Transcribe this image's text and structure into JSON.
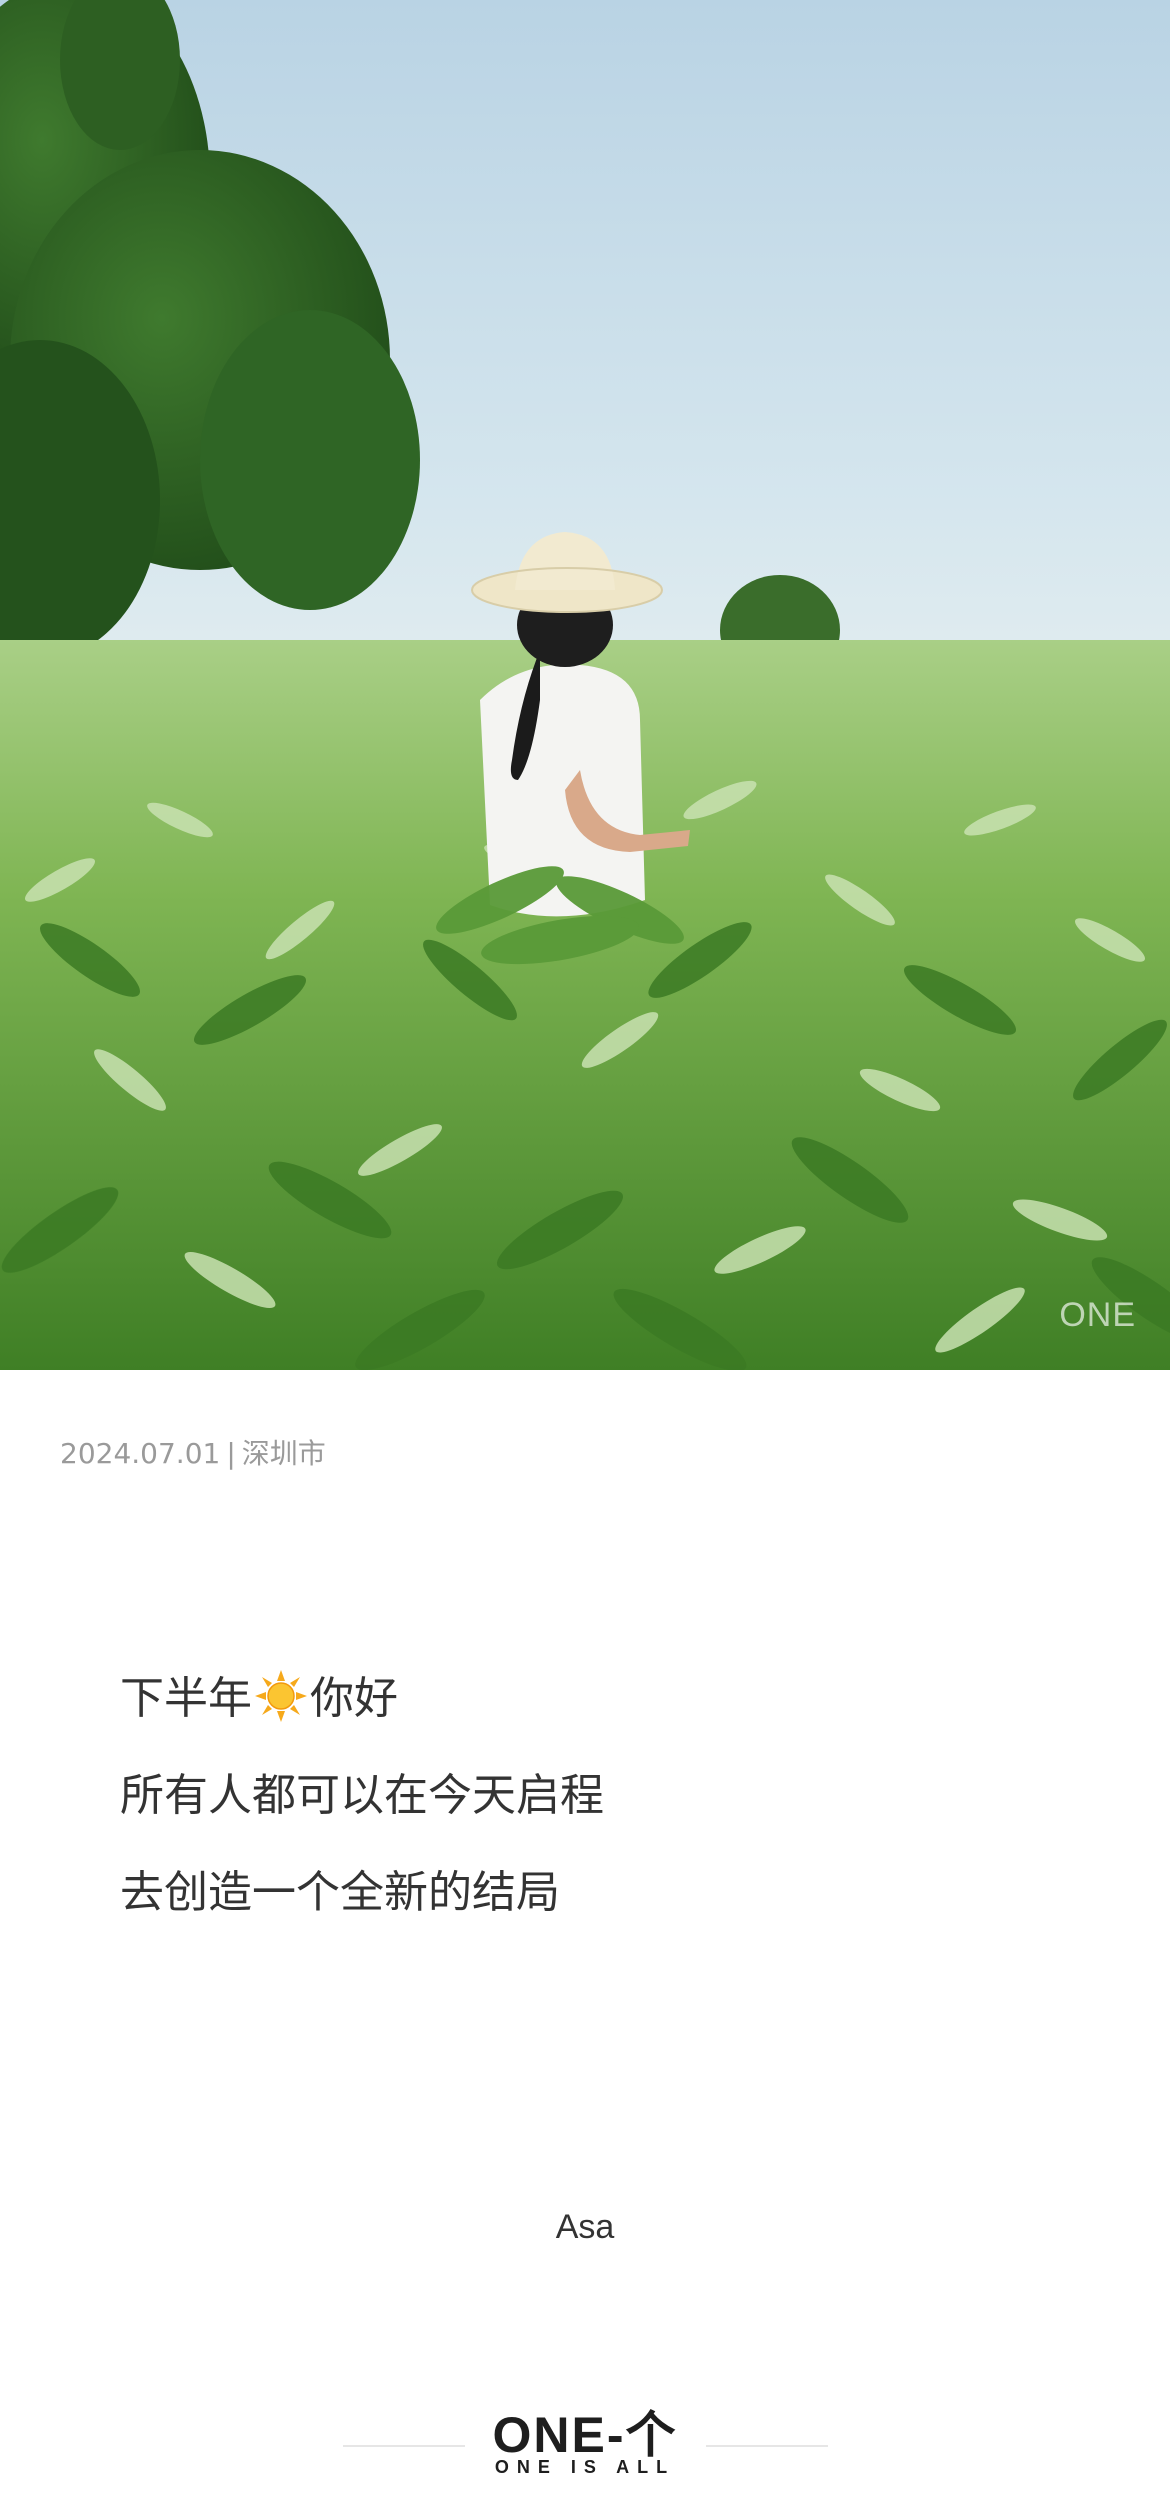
{
  "photo": {
    "watermark": "ONE"
  },
  "meta": {
    "date": "2024.07.01",
    "separator": "|",
    "location": "深圳市"
  },
  "poem": {
    "line1_before": "下半年",
    "line1_icon": "sun-emoji-icon",
    "line1_after": "你好",
    "line2": "所有人都可以在今天启程",
    "line3": "去创造一个全新的结局"
  },
  "author": "Asa",
  "footer": {
    "logo": "ONE-个",
    "tagline": "ONE IS ALL"
  },
  "colors": {
    "text": "#333333",
    "meta": "#9a9a9a",
    "sky": "#cfe3ee",
    "foliage": "#5e9e3a"
  }
}
